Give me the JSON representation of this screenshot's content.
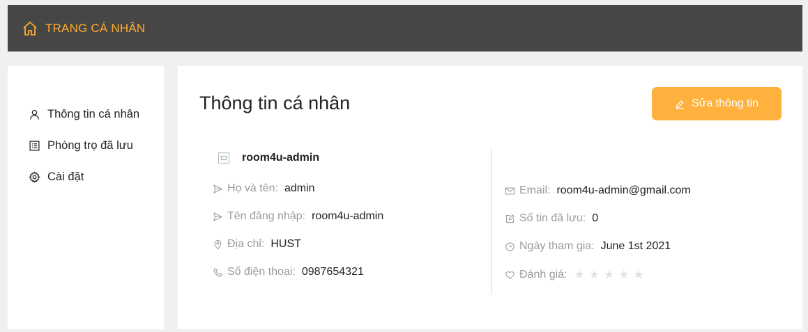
{
  "header": {
    "title": "TRANG CÁ NHÂN",
    "icon": "home-icon",
    "accent": "#ffab2e"
  },
  "sidebar": {
    "items": [
      {
        "label": "Thông tin cá nhân",
        "icon": "user-icon"
      },
      {
        "label": "Phòng trọ đã lưu",
        "icon": "list-icon"
      },
      {
        "label": "Cài đặt",
        "icon": "gear-icon"
      }
    ]
  },
  "main": {
    "title": "Thông tin cá nhân",
    "edit_button": {
      "label": "Sửa thông tin",
      "icon": "edit-icon",
      "color": "#ffb13d"
    },
    "username": "room4u-admin",
    "left_fields": [
      {
        "label": "Họ và tên:",
        "value": "admin",
        "icon": "send-icon"
      },
      {
        "label": "Tên đăng nhập:",
        "value": "room4u-admin",
        "icon": "send-icon"
      },
      {
        "label": "Địa chỉ:",
        "value": "HUST",
        "icon": "location-icon"
      },
      {
        "label": "Số điện thoại:",
        "value": "0987654321",
        "icon": "phone-icon"
      }
    ],
    "right_fields": [
      {
        "label": "Email:",
        "value": "room4u-admin@gmail.com",
        "icon": "mail-icon"
      },
      {
        "label": "Số tin đã lưu:",
        "value": "0",
        "icon": "edit-square-icon"
      },
      {
        "label": "Ngày tham gia:",
        "value": "June 1st 2021",
        "icon": "clock-icon"
      },
      {
        "label": "Đánh giá:",
        "icon": "heart-icon",
        "rating": 0,
        "max_rating": 5
      }
    ]
  }
}
